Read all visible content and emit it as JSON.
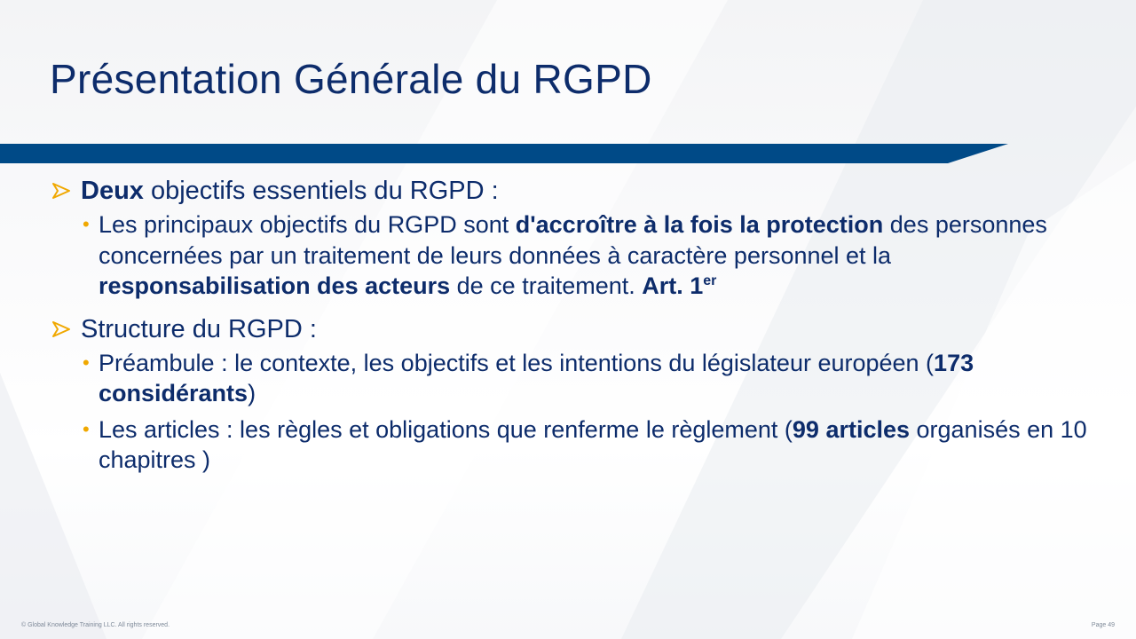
{
  "slide": {
    "title": "Présentation Générale du RGPD",
    "accent_color": "#004a87",
    "text_color": "#0d2c6b",
    "bullet_color": "#f0a800"
  },
  "sections": [
    {
      "heading_bold": "Deux",
      "heading_text": " objectifs essentiels du RGPD :",
      "items": [
        {
          "t1": "Les principaux objectifs du RGPD sont ",
          "b1": "d'accroître à la fois la protection",
          "t2": " des personnes concernées par un traitement de leurs données à caractère personnel et la ",
          "b2": "responsabilisation des acteurs",
          "t3": " de ce traitement. ",
          "b3": "Art. 1",
          "sup": "er"
        }
      ]
    },
    {
      "heading_text": "Structure du RGPD :",
      "items": [
        {
          "t1": "Préambule : le contexte, les objectifs et les intentions du législateur européen (",
          "b1": "173 considérants",
          "t2": ")"
        },
        {
          "t1": "Les articles : les règles et obligations que renferme le règlement (",
          "b1": "99 articles",
          "t2": " organisés en 10 chapitres )"
        }
      ]
    }
  ],
  "footer": {
    "copyright": "© Global Knowledge  Training LLC. All rights reserved.",
    "page": "Page  49"
  }
}
